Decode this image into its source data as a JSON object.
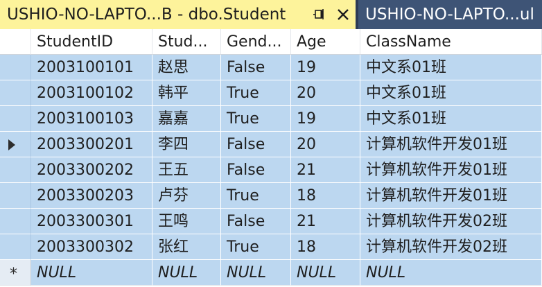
{
  "tabs": {
    "active_title": "USHIO-NO-LAPTO...B - dbo.Student",
    "inactive_title": "USHIO-NO-LAPTO...ul"
  },
  "columns": [
    "StudentID",
    "Stud...",
    "Gend...",
    "Age",
    "ClassName"
  ],
  "rows": [
    [
      "2003100101",
      "赵思",
      "False",
      "19",
      "中文系01班"
    ],
    [
      "2003100102",
      "韩平",
      "True",
      "20",
      "中文系01班"
    ],
    [
      "2003100103",
      "嘉嘉",
      "True",
      "19",
      "中文系01班"
    ],
    [
      "2003300201",
      "李四",
      "False",
      "20",
      "计算机软件开发01班"
    ],
    [
      "2003300202",
      "王五",
      "False",
      "21",
      "计算机软件开发01班"
    ],
    [
      "2003300203",
      "卢芬",
      "True",
      "18",
      "计算机软件开发01班"
    ],
    [
      "2003300301",
      "王鸣",
      "False",
      "21",
      "计算机软件开发02班"
    ],
    [
      "2003300302",
      "张红",
      "True",
      "18",
      "计算机软件开发02班"
    ]
  ],
  "new_row": {
    "marker": "*",
    "values": [
      "NULL",
      "NULL",
      "NULL",
      "NULL",
      "NULL"
    ]
  },
  "current_row_index": 3,
  "colors": {
    "active_tab": "#fdf39b",
    "tab_bar": "#2d3b55",
    "selection": "#bcd7f0"
  },
  "icons": {
    "pin": "pin-icon",
    "close": "close-icon",
    "current_row": "arrow-icon"
  }
}
